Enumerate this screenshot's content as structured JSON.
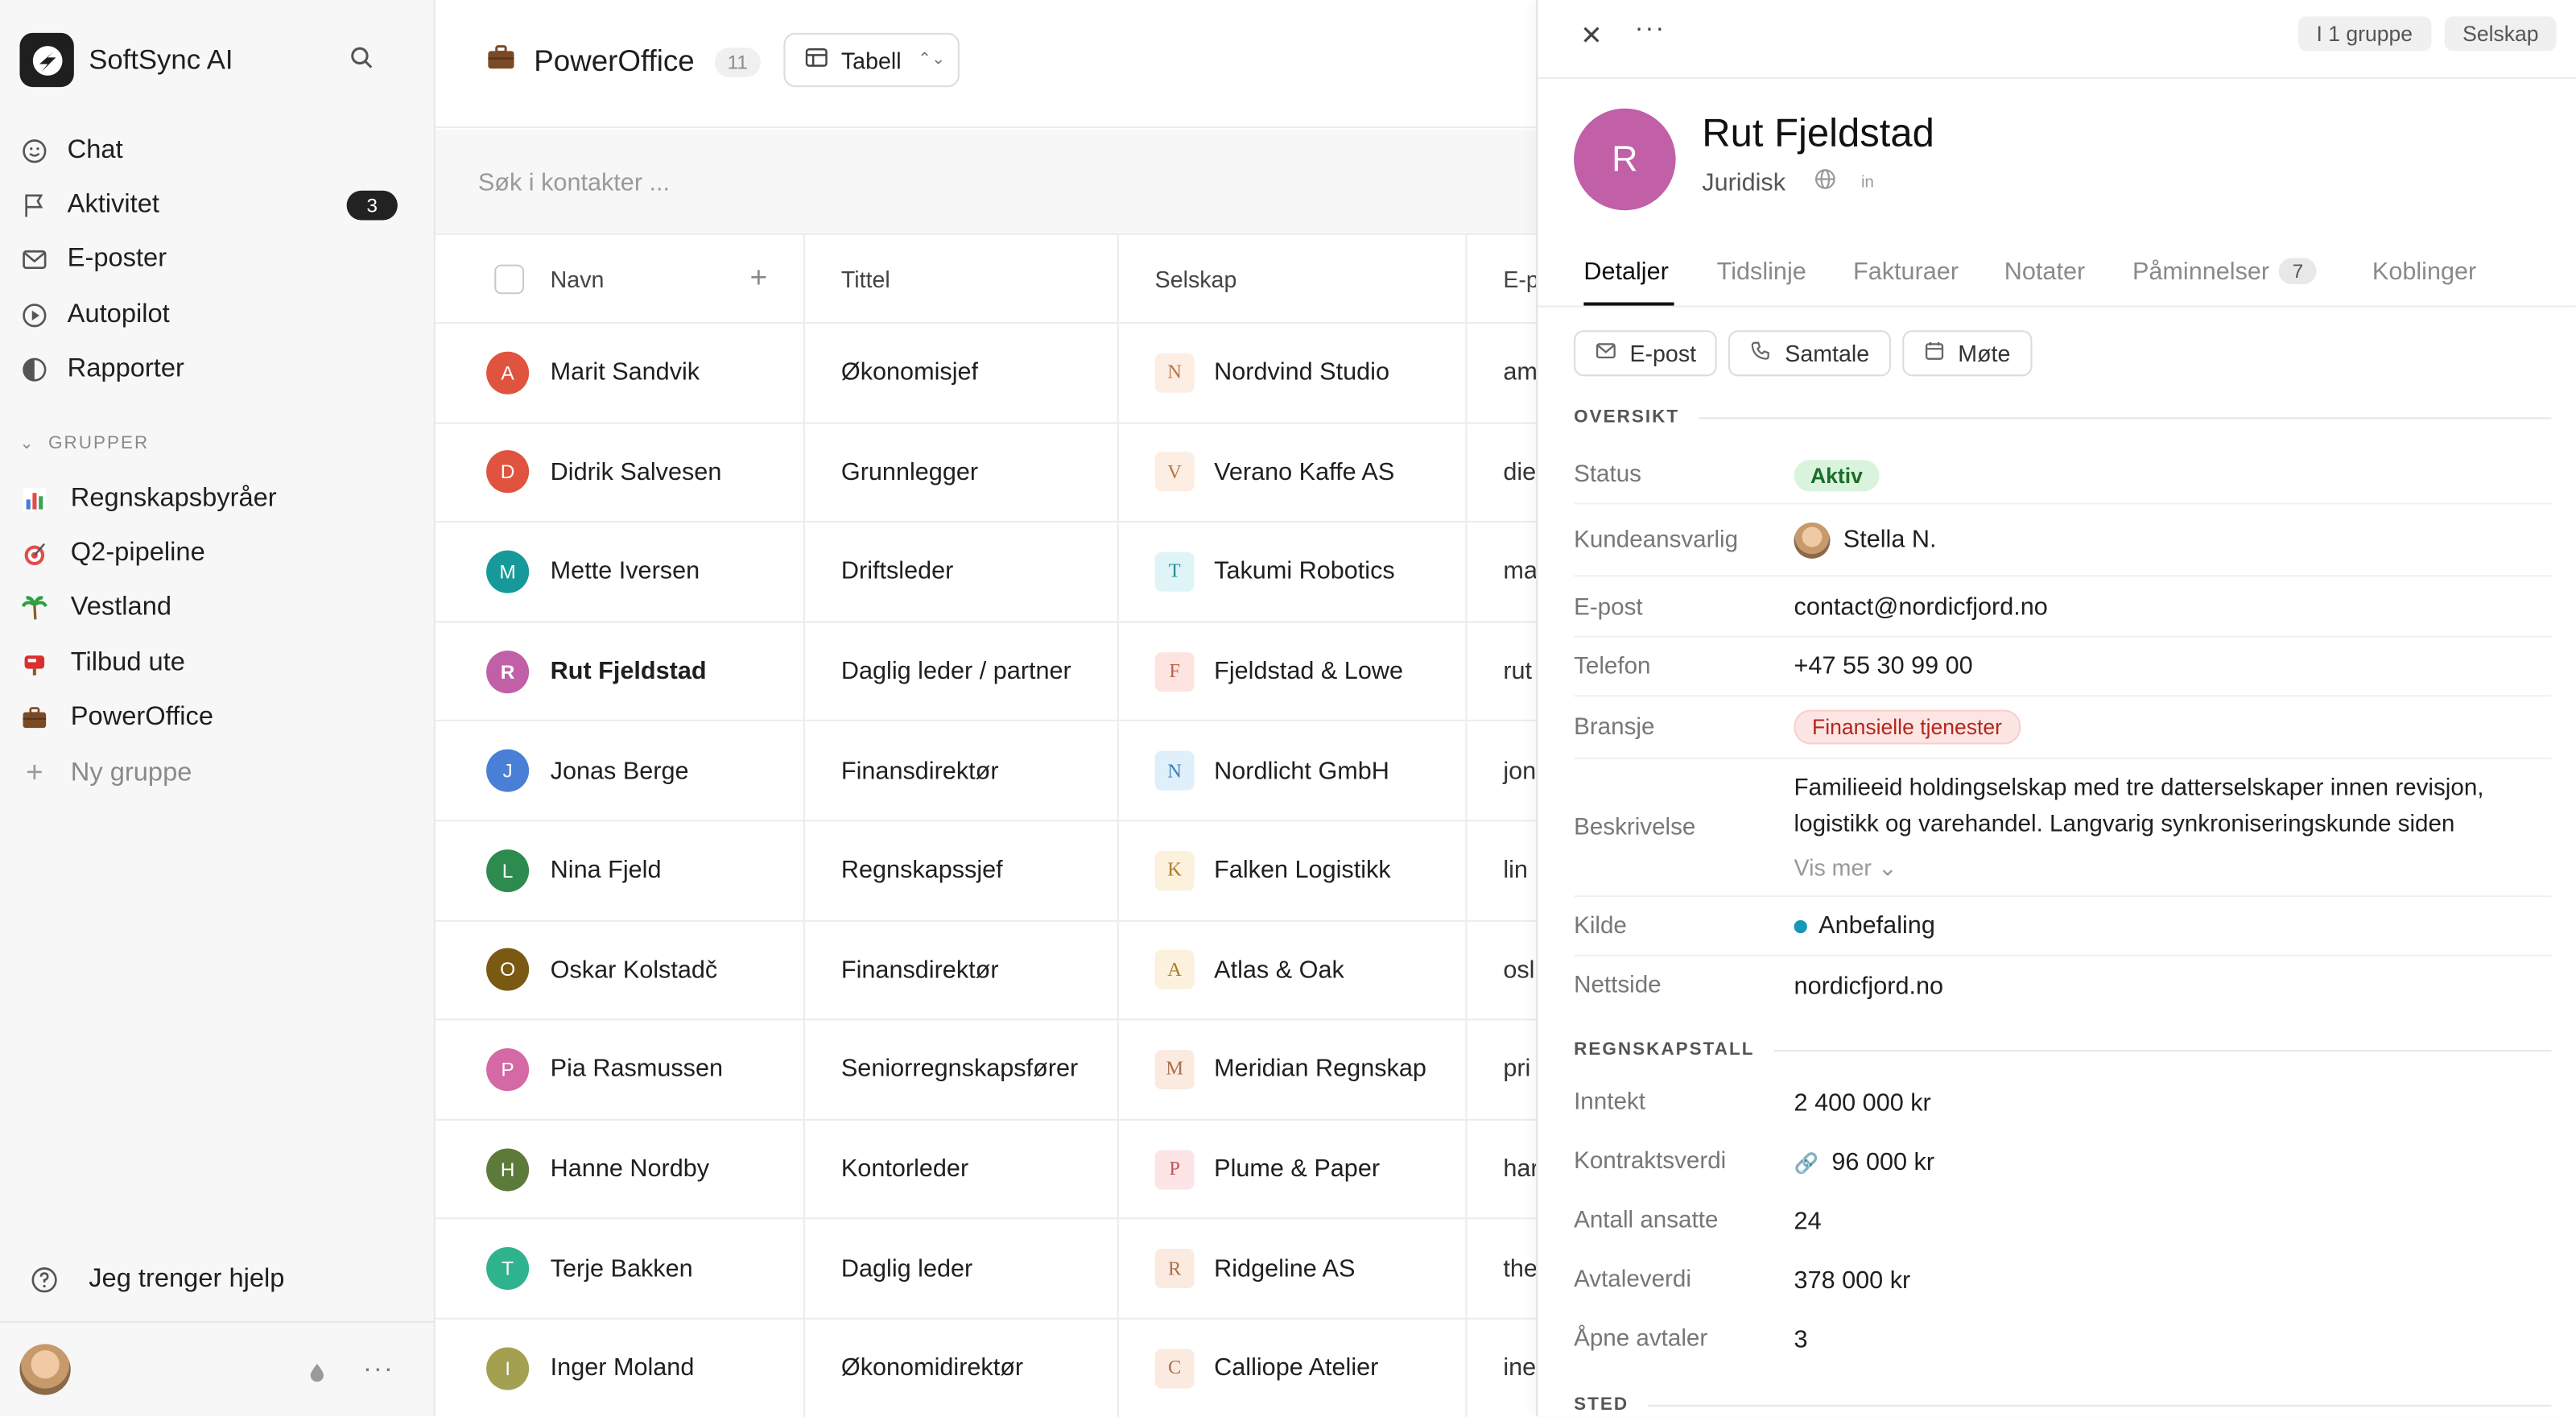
{
  "colors": {
    "accent": "#1f1f1f",
    "status_active": "#1a6d2a",
    "industry": "#b3261e",
    "source_dot": "#1897b8"
  },
  "sidebar": {
    "brand": "SoftSync AI",
    "nav": [
      {
        "label": "Chat",
        "icon": "smile-icon"
      },
      {
        "label": "Aktivitet",
        "icon": "flag-icon",
        "badge": "3"
      },
      {
        "label": "E-poster",
        "icon": "mail-icon"
      },
      {
        "label": "Autopilot",
        "icon": "play-circle-icon"
      },
      {
        "label": "Rapporter",
        "icon": "pie-icon"
      }
    ],
    "groups_heading": "GRUPPER",
    "groups": [
      {
        "label": "Regnskapsbyråer",
        "icon": "bar-chart-emoji"
      },
      {
        "label": "Q2-pipeline",
        "icon": "target-emoji"
      },
      {
        "label": "Vestland",
        "icon": "palm-tree-emoji"
      },
      {
        "label": "Tilbud ute",
        "icon": "mailbox-emoji"
      },
      {
        "label": "PowerOffice",
        "icon": "briefcase-emoji"
      }
    ],
    "new_group": "Ny gruppe",
    "help": "Jeg trenger hjelp"
  },
  "main": {
    "title": "PowerOffice",
    "count": "11",
    "view": "Tabell",
    "search_placeholder": "Søk i kontakter ...",
    "columns": {
      "name": "Navn",
      "title": "Tittel",
      "company": "Selskap",
      "email": "E-p"
    },
    "rows": [
      {
        "initial": "A",
        "color": "#e0533f",
        "name": "Marit Sandvik",
        "title": "Økonomisjef",
        "company": "Nordvind Studio",
        "logo": "N",
        "logo_bg": "#fdeee3",
        "logo_fg": "#b8774a",
        "email": "am"
      },
      {
        "initial": "D",
        "color": "#e0533f",
        "name": "Didrik Salvesen",
        "title": "Grunnlegger",
        "company": "Verano Kaffe AS",
        "logo": "V",
        "logo_bg": "#fdeee3",
        "logo_fg": "#b8774a",
        "email": "die"
      },
      {
        "initial": "M",
        "color": "#17999a",
        "name": "Mette Iversen",
        "title": "Driftsleder",
        "company": "Takumi Robotics",
        "logo": "T",
        "logo_bg": "#dff4f7",
        "logo_fg": "#2a8a9b",
        "email": "ma"
      },
      {
        "initial": "R",
        "color": "#c15fa7",
        "name": "Rut Fjeldstad",
        "title": "Daglig leder / partner",
        "company": "Fjeldstad & Lowe",
        "logo": "F",
        "logo_bg": "#fde4e0",
        "logo_fg": "#c0604e",
        "email": "rut",
        "selected": true
      },
      {
        "initial": "J",
        "color": "#4a7fd6",
        "name": "Jonas Berge",
        "title": "Finansdirektør",
        "company": "Nordlicht GmbH",
        "logo": "N",
        "logo_bg": "#dff0fb",
        "logo_fg": "#3b82b5",
        "email": "jon"
      },
      {
        "initial": "L",
        "color": "#2e8b4f",
        "name": "Nina Fjeld",
        "title": "Regnskapssjef",
        "company": "Falken Logistikk",
        "logo": "K",
        "logo_bg": "#fbf1dc",
        "logo_fg": "#a97c2c",
        "email": "lin"
      },
      {
        "initial": "O",
        "color": "#7a5a12",
        "name": "Oskar Kolstadč",
        "title": "Finansdirektør",
        "company": "Atlas & Oak",
        "logo": "A",
        "logo_bg": "#fbf1dc",
        "logo_fg": "#a97c2c",
        "email": "osl"
      },
      {
        "initial": "P",
        "color": "#d469a6",
        "name": "Pia Rasmussen",
        "title": "Seniorregnskapsfører",
        "company": "Meridian Regnskap",
        "logo": "M",
        "logo_bg": "#fbeadf",
        "logo_fg": "#a9714d",
        "email": "pri"
      },
      {
        "initial": "H",
        "color": "#5c7a3a",
        "name": "Hanne Nordby",
        "title": "Kontorleder",
        "company": "Plume & Paper",
        "logo": "P",
        "logo_bg": "#fde4e6",
        "logo_fg": "#c2555f",
        "email": "har"
      },
      {
        "initial": "T",
        "color": "#2fb38e",
        "name": "Terje Bakken",
        "title": "Daglig leder",
        "company": "Ridgeline AS",
        "logo": "R",
        "logo_bg": "#fbeadf",
        "logo_fg": "#a9714d",
        "email": "the"
      },
      {
        "initial": "I",
        "color": "#a3a052",
        "name": "Inger Moland",
        "title": "Økonomidirektør",
        "company": "Calliope Atelier",
        "logo": "C",
        "logo_bg": "#fbeadf",
        "logo_fg": "#a9714d",
        "email": "ine"
      }
    ]
  },
  "panel": {
    "chip_group": "I 1 gruppe",
    "chip_company": "Selskap",
    "initial": "R",
    "name": "Rut Fjeldstad",
    "department": "Juridisk",
    "linkedin": "in",
    "tabs": [
      {
        "label": "Detaljer"
      },
      {
        "label": "Tidslinje"
      },
      {
        "label": "Fakturaer"
      },
      {
        "label": "Notater"
      },
      {
        "label": "Påminnelser",
        "count": "7"
      },
      {
        "label": "Koblinger"
      }
    ],
    "actions": {
      "email": "E-post",
      "call": "Samtale",
      "meeting": "Møte"
    },
    "overview_heading": "OVERSIKT",
    "fields": {
      "status_label": "Status",
      "status": "Aktiv",
      "owner_label": "Kundeansvarlig",
      "owner": "Stella N.",
      "email_label": "E-post",
      "email": "contact@nordicfjord.no",
      "phone_label": "Telefon",
      "phone": "+47 55 30 99 00",
      "industry_label": "Bransje",
      "industry": "Finansielle tjenester",
      "description_label": "Beskrivelse",
      "description": "Familieeid holdingselskap med tre datterselskaper innen revisjon, logistikk og varehandel. Langvarig synkroniseringskunde siden",
      "show_more": "Vis mer",
      "source_label": "Kilde",
      "source": "Anbefaling",
      "website_label": "Nettside",
      "website": "nordicfjord.no"
    },
    "finance_heading": "REGNSKAPSTALL",
    "finance": {
      "revenue_label": "Inntekt",
      "revenue": "2 400 000 kr",
      "contract_label": "Kontraktsverdi",
      "contract": "96 000 kr",
      "employees_label": "Antall ansatte",
      "employees": "24",
      "deal_label": "Avtaleverdi",
      "deal": "378 000 kr",
      "open_label": "Åpne avtaler",
      "open": "3"
    },
    "location_heading": "STED"
  }
}
